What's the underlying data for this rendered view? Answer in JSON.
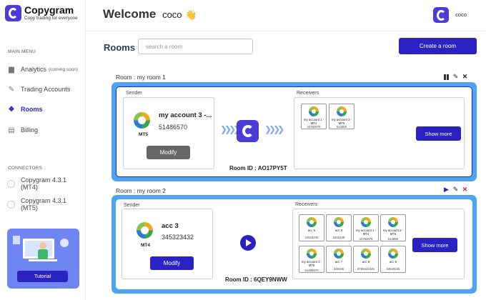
{
  "brand": {
    "name": "Copygram",
    "tagline": "Copy trading for everyone"
  },
  "sidebar": {
    "main_menu_label": "MAIN MENU",
    "items": [
      {
        "label": "Analytics",
        "note": "(coming soon)",
        "icon": "chart-icon"
      },
      {
        "label": "Trading Accounts",
        "icon": "wrench-icon"
      },
      {
        "label": "Rooms",
        "icon": "dropbox-icon",
        "active": true
      },
      {
        "label": "Billing",
        "icon": "document-icon"
      }
    ],
    "connectors_label": "CONNECTORS",
    "connectors": [
      {
        "label": "Copygram 4.3.1 (MT4)"
      },
      {
        "label": "Copygram 4.3.1 (MT5)"
      }
    ],
    "tutorial_label": "Tutorial"
  },
  "header": {
    "welcome": "Welcome",
    "user": "coco",
    "emoji": "👋",
    "avatar_user": "coco"
  },
  "rooms_page": {
    "title": "Rooms",
    "search_placeholder": "search a room",
    "create_label": "Create a room"
  },
  "rooms": [
    {
      "label": "Room : my room 1",
      "sender_title": "Sender",
      "receivers_title": "Receivers",
      "account_name": "my account 3 -...",
      "account_number": "51486570",
      "platform": "MT5",
      "modify_label": "Modify",
      "room_id": "Room ID : AO17PY5T",
      "show_more": "Show more",
      "state": "running",
      "receivers": [
        {
          "name": "my account 1 - MT4",
          "number": "44762678"
        },
        {
          "name": "my account 3 - MT5",
          "number": "514850"
        }
      ]
    },
    {
      "label": "Room : my room 2",
      "sender_title": "Sender",
      "receivers_title": "Receivers",
      "account_name": "acc 3",
      "account_number": "345323432",
      "platform": "MT4",
      "modify_label": "Modify",
      "room_id": "Room ID : 6QEY9NWW",
      "show_more": "Show more",
      "state": "paused",
      "receivers": [
        {
          "name": "acc 6",
          "number": "34543245"
        },
        {
          "name": "acc 9",
          "number": "2342345"
        },
        {
          "name": "my account 1 - MT4",
          "number": "44762678"
        },
        {
          "name": "my account 2 - MT5",
          "number": "514850"
        },
        {
          "name": "my account 3 - MT5",
          "number": "51486570"
        },
        {
          "name": "acc 7",
          "number": "345345"
        },
        {
          "name": "acc 8",
          "number": "8765444345"
        },
        {
          "name": "acc 5",
          "number": "34543245"
        }
      ]
    }
  ],
  "colors": {
    "accent": "#2b22c4",
    "frame": "#4da4f2",
    "logo": "#4b3bd9",
    "disabled": "#666666"
  }
}
